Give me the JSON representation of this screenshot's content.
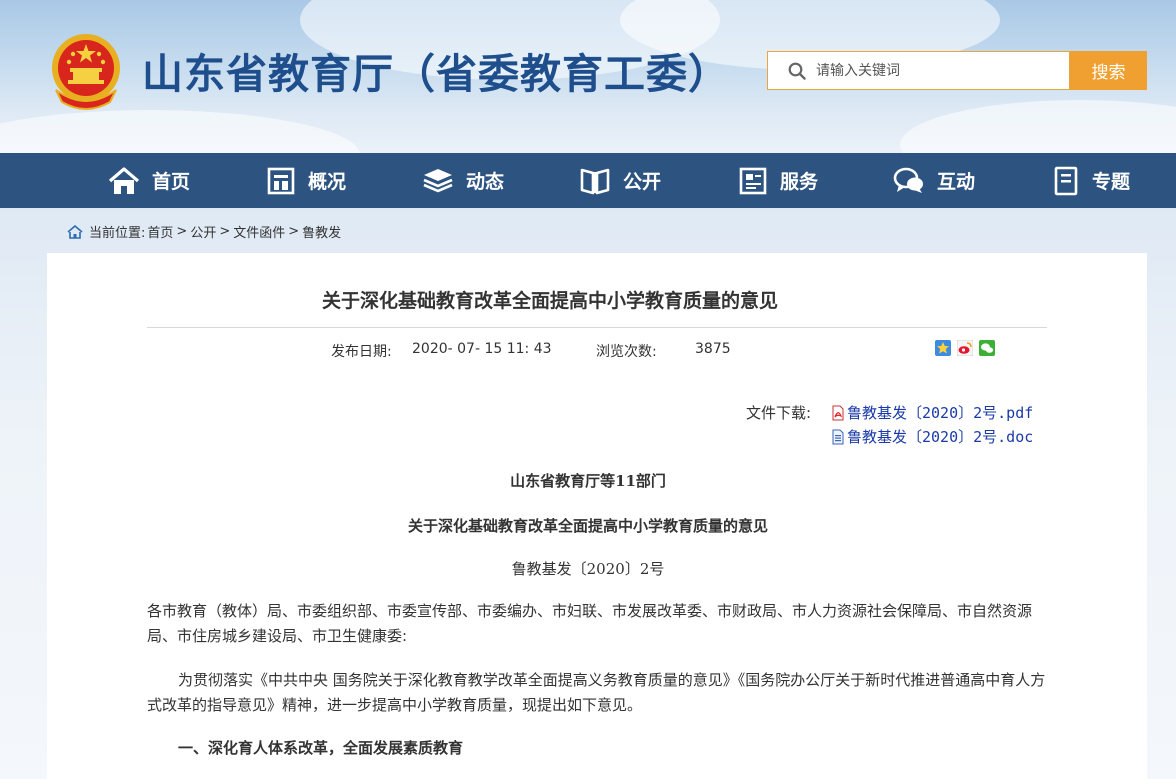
{
  "header": {
    "site_title": "山东省教育厅（省委教育工委）",
    "search_placeholder": "请输入关键词",
    "search_button": "搜索"
  },
  "nav": {
    "items": [
      {
        "label": "首页",
        "icon": "home-icon"
      },
      {
        "label": "概况",
        "icon": "building-icon"
      },
      {
        "label": "动态",
        "icon": "stack-icon"
      },
      {
        "label": "公开",
        "icon": "book-icon"
      },
      {
        "label": "服务",
        "icon": "service-icon"
      },
      {
        "label": "互动",
        "icon": "chat-icon"
      },
      {
        "label": "专题",
        "icon": "document-icon"
      }
    ]
  },
  "breadcrumb": {
    "prefix": "当前位置:",
    "items": [
      "首页",
      "公开",
      "文件函件",
      "鲁教发"
    ],
    "separator": ">"
  },
  "article": {
    "title": "关于深化基础教育改革全面提高中小学教育质量的意见",
    "publish_label": "发布日期:",
    "publish_date": "2020- 07- 15 11: 43",
    "views_label": "浏览次数:",
    "views": "3875",
    "download_label": "文件下载:",
    "downloads": [
      {
        "name": "鲁教基发〔2020〕2号.pdf",
        "icon": "pdf-icon"
      },
      {
        "name": "鲁教基发〔2020〕2号.doc",
        "icon": "doc-icon"
      }
    ],
    "issuer": "山东省教育厅等11部门",
    "doc_title": "关于深化基础教育改革全面提高中小学教育质量的意见",
    "doc_number": "鲁教基发〔2020〕2号",
    "recipients": "各市教育（教体）局、市委组织部、市委宣传部、市委编办、市妇联、市发展改革委、市财政局、市人力资源社会保障局、市自然资源局、市住房城乡建设局、市卫生健康委:",
    "paragraph1": "为贯彻落实《中共中央 国务院关于深化教育教学改革全面提高义务教育质量的意见》《国务院办公厅关于新时代推进普通高中育人方式改革的指导意见》精神，进一步提高中小学教育质量，现提出如下意见。",
    "section1": "一、深化育人体系改革，全面发展素质教育"
  },
  "colors": {
    "nav_bg": "#2d5480",
    "title_blue": "#1f4e8c",
    "search_orange": "#f0a030",
    "link_blue": "#1a3aa8"
  }
}
